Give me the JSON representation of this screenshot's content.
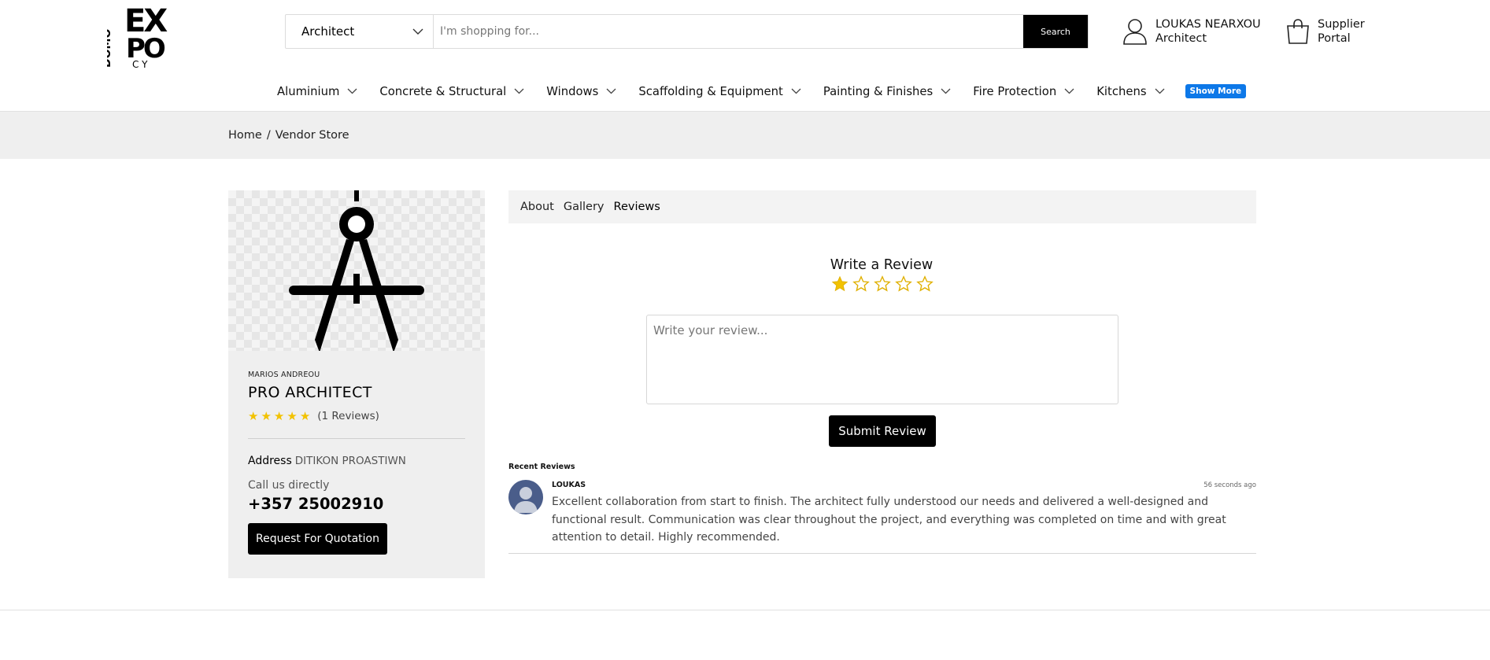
{
  "header": {
    "logo": {
      "line1": "EX",
      "line2": "PO",
      "side": "DOMO",
      "bottom": "CY"
    },
    "search": {
      "category": "Architect",
      "placeholder": "I'm shopping for...",
      "button_label": "Search"
    },
    "user": {
      "name": "LOUKAS NEARXOU",
      "role": "Architect"
    },
    "supplier": {
      "line1": "Supplier",
      "line2": "Portal"
    }
  },
  "nav": {
    "items": [
      {
        "label": "Aluminium"
      },
      {
        "label": "Concrete & Structural"
      },
      {
        "label": "Windows"
      },
      {
        "label": "Scaffolding & Equipment"
      },
      {
        "label": "Painting & Finishes"
      },
      {
        "label": "Fire Protection"
      },
      {
        "label": "Kitchens"
      }
    ],
    "show_more": "Show More"
  },
  "breadcrumb": {
    "home": "Home",
    "separator": "/",
    "current": "Vendor Store"
  },
  "vendor": {
    "owner": "MARIOS ANDREOU",
    "company": "PRO ARCHITECT",
    "rating": 5,
    "reviews_count": "(1 Reviews)",
    "address_label": "Address",
    "address": "DITIKON PROASTIWN",
    "call_label": "Call us directly",
    "phone": "+357 25002910",
    "rfq_button": "Request For Quotation",
    "image_icon": "architect-compass-icon"
  },
  "tabs": [
    {
      "label": "About"
    },
    {
      "label": "Gallery"
    },
    {
      "label": "Reviews",
      "active": true
    }
  ],
  "review_form": {
    "title": "Write a Review",
    "selected_stars": 1,
    "total_stars": 5,
    "placeholder": "Write your review...",
    "submit": "Submit Review"
  },
  "recent": {
    "title": "Recent Reviews",
    "items": [
      {
        "name": "LOUKAS",
        "time": "56 seconds ago",
        "text": "Excellent collaboration from start to finish. The architect fully understood our needs and delivered a well-designed and functional result. Communication was clear throughout the project, and everything was completed on time and with great attention to detail. Highly recommended."
      }
    ]
  },
  "colors": {
    "accent": "#0d78e8",
    "star": "#f2c200",
    "primary": "#000000"
  }
}
